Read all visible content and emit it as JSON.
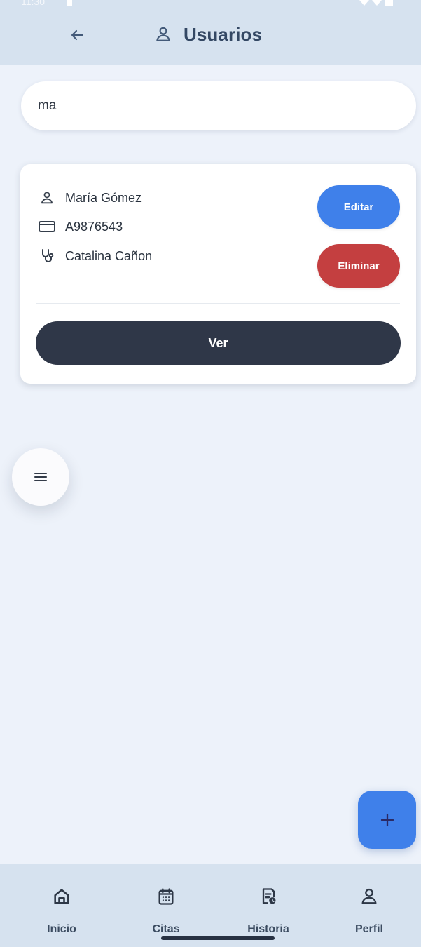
{
  "status_bar": {
    "time": "11:30"
  },
  "header": {
    "title": "Usuarios",
    "back_icon": "arrow-left-icon",
    "title_icon": "user-icon"
  },
  "search": {
    "value": "ma",
    "placeholder": ""
  },
  "user_card": {
    "name": "María Gómez",
    "document": "A9876543",
    "doctor": "Catalina Cañon",
    "icons": {
      "name": "user-icon",
      "document": "id-card-icon",
      "doctor": "stethoscope-icon"
    },
    "edit_label": "Editar",
    "delete_label": "Eliminar",
    "view_label": "Ver"
  },
  "floating_actions": {
    "menu_icon": "menu-icon",
    "add_icon": "plus-icon"
  },
  "bottom_nav": {
    "items": [
      {
        "label": "Inicio",
        "icon": "home-icon"
      },
      {
        "label": "Citas",
        "icon": "calendar-icon"
      },
      {
        "label": "Historia",
        "icon": "history-icon"
      },
      {
        "label": "Perfil",
        "icon": "user-icon"
      }
    ]
  },
  "colors": {
    "header_bg": "#d6e2ef",
    "page_bg": "#edf2fa",
    "primary": "#3f80ea",
    "danger": "#c43f40",
    "dark_button": "#2f3748",
    "text_primary": "#344864"
  }
}
